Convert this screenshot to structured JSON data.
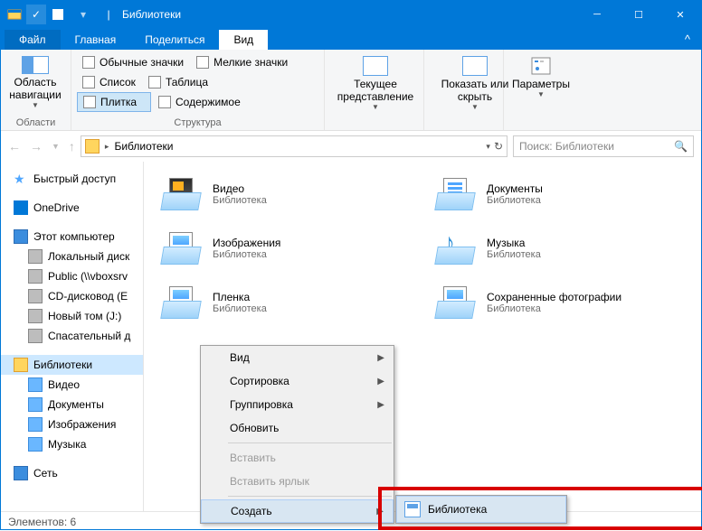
{
  "title": "Библиотеки",
  "tabs": {
    "file": "Файл",
    "main": "Главная",
    "share": "Поделиться",
    "view": "Вид"
  },
  "ribbon": {
    "nav": "Область навигации",
    "nav_group": "Области",
    "icons_large": "Обычные значки",
    "icons_small": "Мелкие значки",
    "list": "Список",
    "table": "Таблица",
    "tiles": "Плитка",
    "content": "Содержимое",
    "struct_group": "Структура",
    "current": "Текущее представление",
    "show": "Показать или скрыть",
    "options": "Параметры"
  },
  "addr": {
    "location": "Библиотеки",
    "search_placeholder": "Поиск: Библиотеки"
  },
  "tree": {
    "quick": "Быстрый доступ",
    "onedrive": "OneDrive",
    "pc": "Этот компьютер",
    "disks": [
      "Локальный диск",
      "Public (\\\\vboxsrv",
      "CD-дисковод (E",
      "Новый том (J:)",
      "Спасательный д"
    ],
    "libs": "Библиотеки",
    "libitems": [
      "Видео",
      "Документы",
      "Изображения",
      "Музыка"
    ],
    "net": "Сеть"
  },
  "libs": [
    {
      "name": "Видео",
      "sub": "Библиотека"
    },
    {
      "name": "Документы",
      "sub": "Библиотека"
    },
    {
      "name": "Изображения",
      "sub": "Библиотека"
    },
    {
      "name": "Музыка",
      "sub": "Библиотека"
    },
    {
      "name": "Пленка",
      "sub": "Библиотека"
    },
    {
      "name": "Сохраненные фотографии",
      "sub": "Библиотека"
    }
  ],
  "ctx": {
    "view": "Вид",
    "sort": "Сортировка",
    "group": "Группировка",
    "refresh": "Обновить",
    "paste": "Вставить",
    "paste_shortcut": "Вставить ярлык",
    "create": "Создать",
    "sub_lib": "Библиотека"
  },
  "status": {
    "count": "Элементов: 6"
  }
}
